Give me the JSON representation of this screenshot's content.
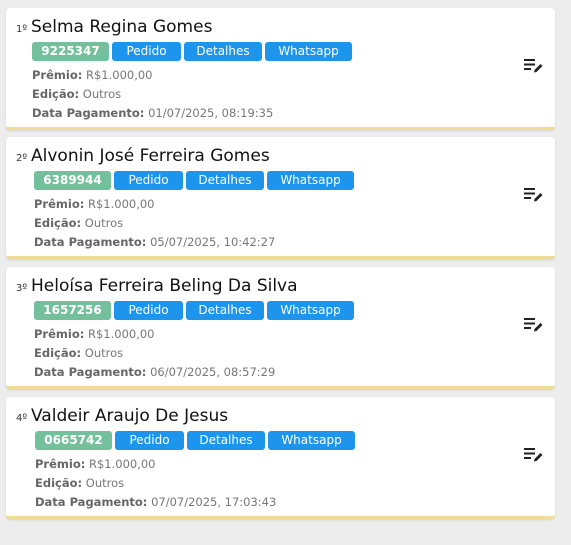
{
  "labels": {
    "premio": "Prêmio:",
    "edicao": "Edição:",
    "data_pagamento": "Data Pagamento:",
    "pedido": "Pedido",
    "detalhes": "Detalhes",
    "whatsapp": "Whatsapp"
  },
  "icons": {
    "edit": "playlist-edit-icon"
  },
  "colors": {
    "code_badge": "#74bf9c",
    "button": "#1e95ec",
    "card_accent": "#f1dc97"
  },
  "winners": [
    {
      "rank": "1º",
      "name": "Selma Regina Gomes",
      "code": "9225347",
      "premio": "R$1.000,00",
      "edicao": "Outros",
      "data_pagamento": "01/07/2025, 08:19:35"
    },
    {
      "rank": "2º",
      "name": "Alvonin José Ferreira Gomes",
      "code": "6389944",
      "premio": "R$1.000,00",
      "edicao": "Outros",
      "data_pagamento": "05/07/2025, 10:42:27"
    },
    {
      "rank": "3º",
      "name": "Heloísa Ferreira Beling Da Silva",
      "code": "1657256",
      "premio": "R$1.000,00",
      "edicao": "Outros",
      "data_pagamento": "06/07/2025, 08:57:29"
    },
    {
      "rank": "4º",
      "name": "Valdeir Araujo De Jesus",
      "code": "0665742",
      "premio": "R$1.000,00",
      "edicao": "Outros",
      "data_pagamento": "07/07/2025, 17:03:43"
    }
  ]
}
